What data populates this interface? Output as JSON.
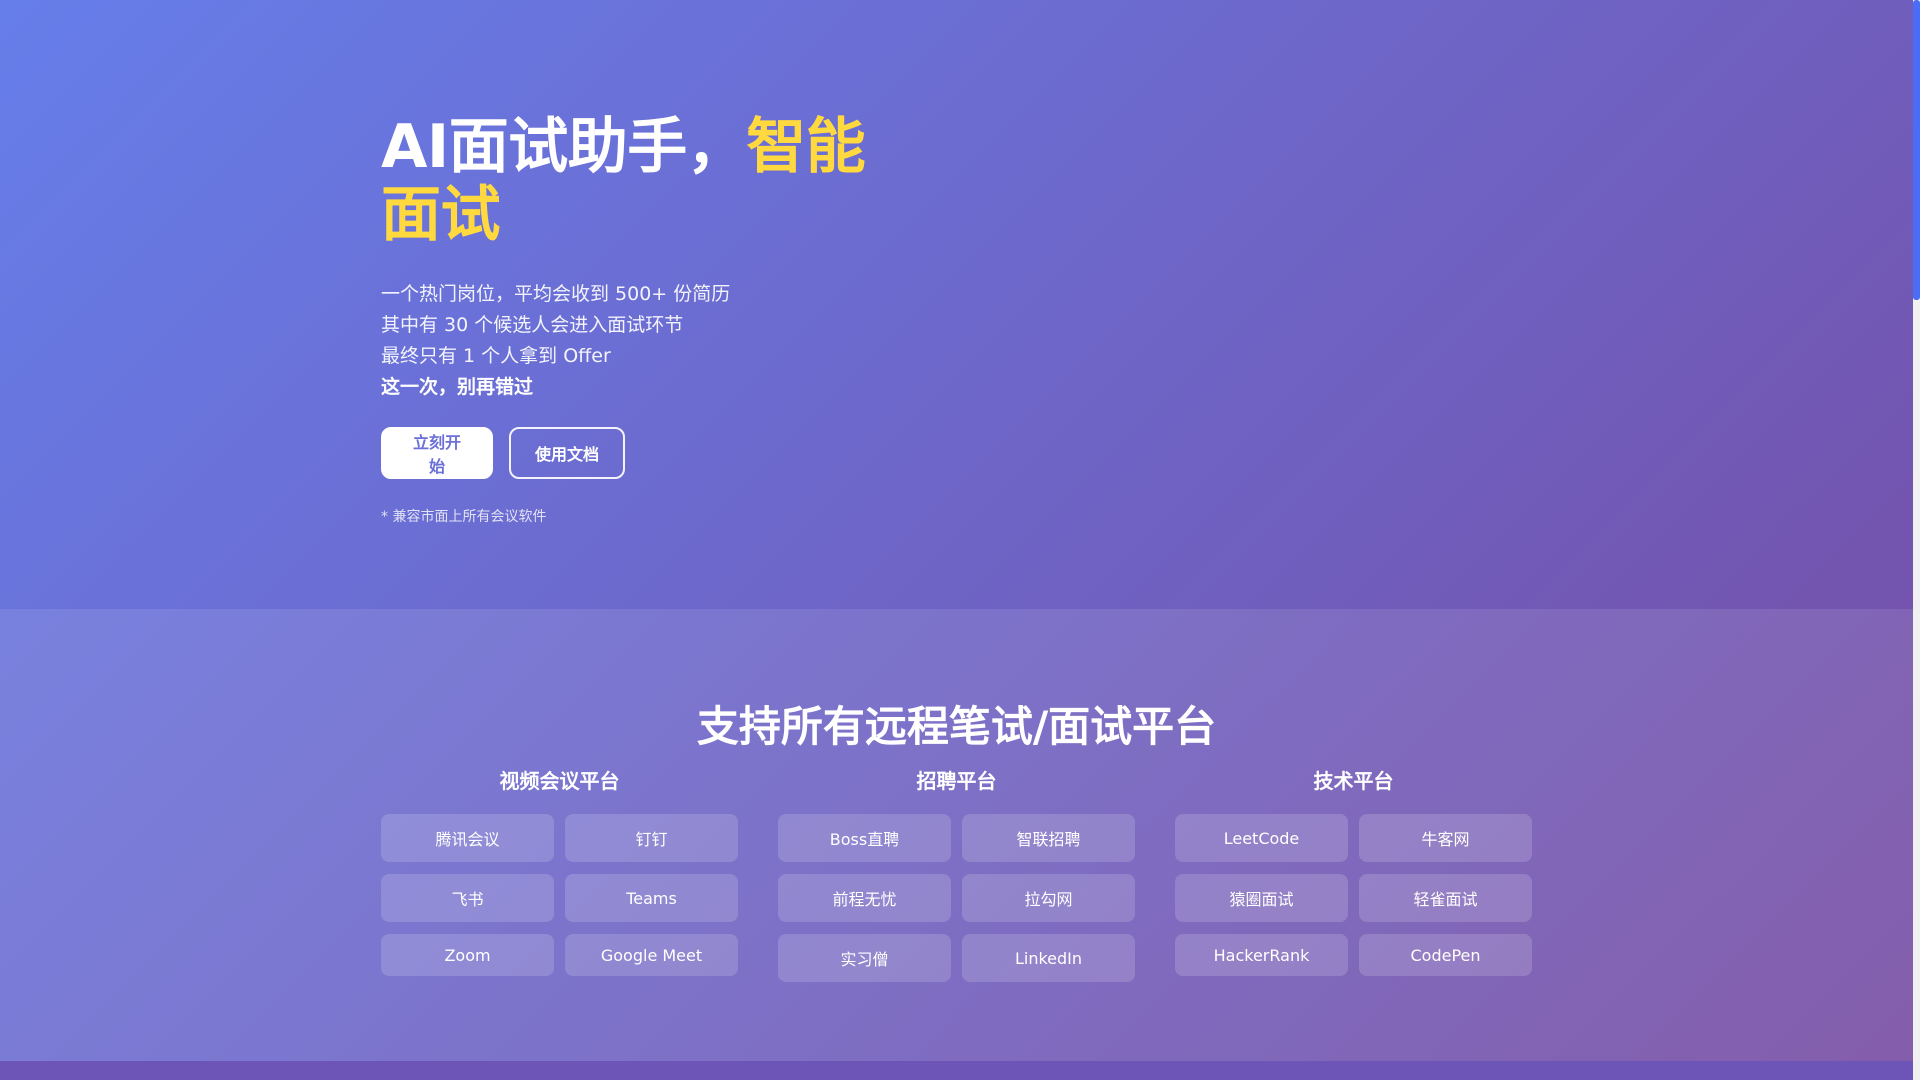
{
  "hero": {
    "title_main": "AI面试助手，",
    "title_accent": "智能面试",
    "desc_lines": [
      "一个热门岗位，平均会收到 500+ 份简历",
      "其中有 30 个候选人会进入面试环节",
      "最终只有 1 个人拿到 Offer"
    ],
    "desc_strong": "这一次，别再错过",
    "primary_button": "立刻开始",
    "secondary_button": "使用文档",
    "note": "* 兼容市面上所有会议软件"
  },
  "platforms": {
    "title": "支持所有远程笔试/面试平台",
    "groups": [
      {
        "title": "视频会议平台",
        "items": [
          "腾讯会议",
          "钉钉",
          "飞书",
          "Teams",
          "Zoom",
          "Google Meet"
        ]
      },
      {
        "title": "招聘平台",
        "items": [
          "Boss直聘",
          "智联招聘",
          "前程无忧",
          "拉勾网",
          "实习僧",
          "LinkedIn"
        ]
      },
      {
        "title": "技术平台",
        "items": [
          "LeetCode",
          "牛客网",
          "猿圈面试",
          "轻雀面试",
          "HackerRank",
          "CodePen"
        ]
      }
    ]
  },
  "colors": {
    "accent": "#ffd93d",
    "gradient_start": "#667eea",
    "gradient_end": "#764ba2",
    "primary_button_text": "#6b6fd8"
  }
}
